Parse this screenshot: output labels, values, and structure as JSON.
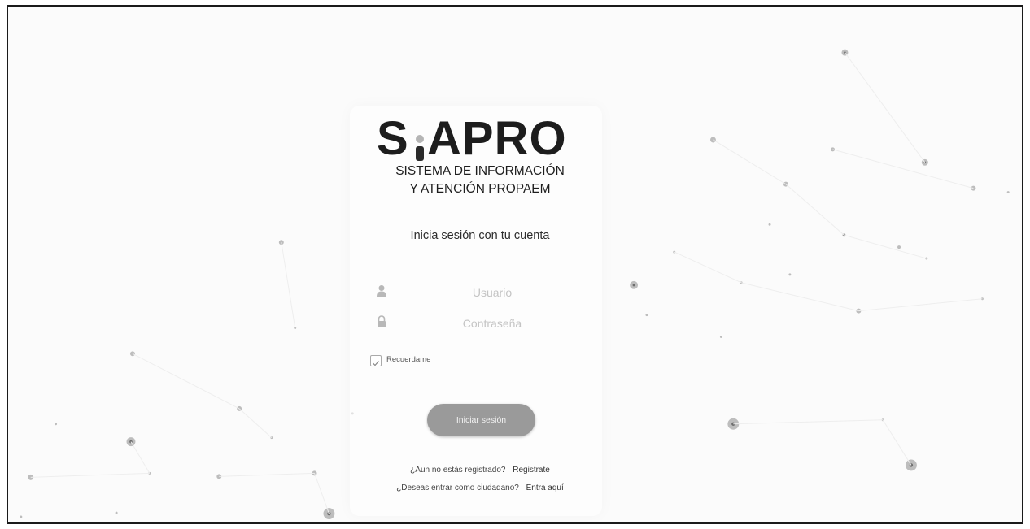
{
  "logo": {
    "letter_s": "S",
    "letters_rest": "APRO",
    "subtitle_line1": "SISTEMA DE INFORMACIÓN",
    "subtitle_line2": "Y ATENCIÓN PROPAEM"
  },
  "login": {
    "heading": "Inicia sesión con tu cuenta",
    "username_placeholder": "Usuario",
    "password_placeholder": "Contraseña",
    "username_icon": "user-icon",
    "password_icon": "lock-icon",
    "remember_label": "Recuerdame",
    "remember_checked": true,
    "submit_label": "Iniciar sesión"
  },
  "links": {
    "register_prompt": "¿Aun no estás registrado?",
    "register_link": "Registrate",
    "citizen_prompt": "¿Deseas entrar como ciudadano?",
    "citizen_link": "Entra aquí"
  },
  "colors": {
    "button": "#9a9a9a",
    "text": "#2c2c2c",
    "background": "#fbfbfb"
  }
}
